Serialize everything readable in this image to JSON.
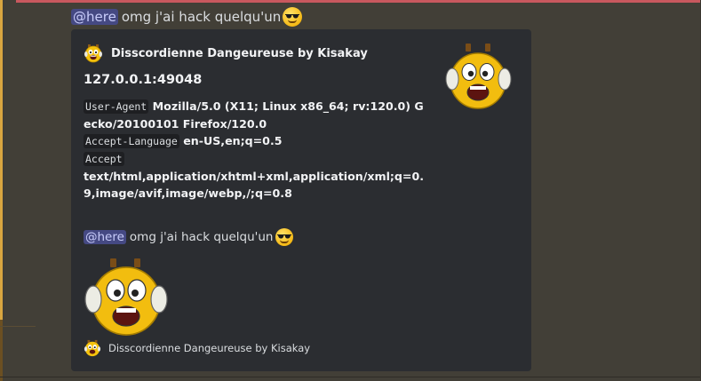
{
  "message": {
    "mention": "@here",
    "text": "omg j'ai hack quelqu'un",
    "emoji": "sunglasses-emoji"
  },
  "embed": {
    "author": "Disscordienne Dangeureuse by Kisakay",
    "title": "127.0.0.1:49048",
    "fields": {
      "ua_key": "User-Agent",
      "ua_value": "Mozilla/5.0 (X11; Linux x86_64; rv:120.0) Gecko/20100101 Firefox/120.0",
      "lang_key": "Accept-Language",
      "lang_value": "en-US,en;q=0.5",
      "accept_key": "Accept",
      "accept_value": "text/html,application/xhtml+xml,application/xml;q=0.9,image/avif,image/webp,/;q=0.8"
    },
    "inner_message": {
      "mention": "@here",
      "text": "omg j'ai hack quelqu'un"
    },
    "footer": "Disscordienne Dangeureuse by Kisakay",
    "images": {
      "thumbnail": "shocked-face-image",
      "main": "shocked-face-image"
    }
  },
  "colors": {
    "background": "#423f37",
    "embed_bg": "#2b2d31",
    "mention_bg": "#454983",
    "mention_text": "#c9cdfb",
    "highlight_bar": "#d9a640",
    "top_line": "#c8585e"
  }
}
